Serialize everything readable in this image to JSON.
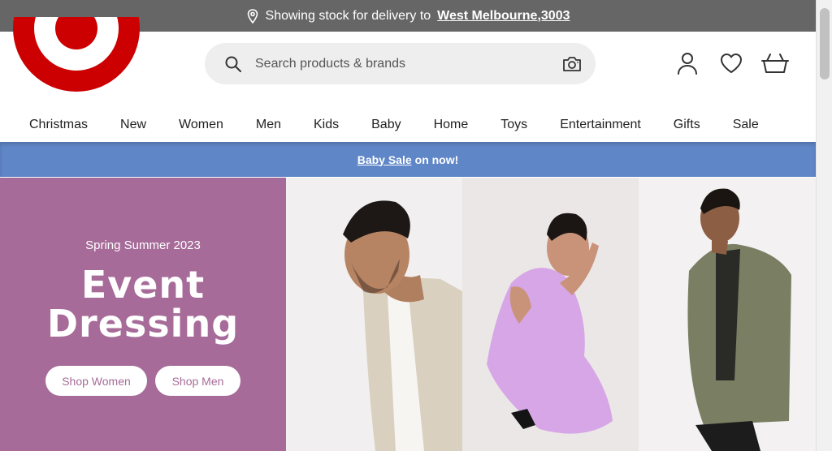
{
  "delivery_bar": {
    "prefix": "Showing stock for delivery to",
    "location": "West Melbourne,3003",
    "pin_icon": "location-pin-icon"
  },
  "header": {
    "logo_icon": "target-bullseye-logo",
    "search": {
      "placeholder": "Search products & brands",
      "icon": "search-icon",
      "camera_icon": "camera-icon"
    },
    "icons": [
      "account-icon",
      "wishlist-heart-icon",
      "cart-basket-icon"
    ]
  },
  "nav": {
    "items": [
      {
        "label": "Christmas"
      },
      {
        "label": "New"
      },
      {
        "label": "Women"
      },
      {
        "label": "Men"
      },
      {
        "label": "Kids"
      },
      {
        "label": "Baby"
      },
      {
        "label": "Home"
      },
      {
        "label": "Toys"
      },
      {
        "label": "Entertainment"
      },
      {
        "label": "Gifts"
      },
      {
        "label": "Sale"
      }
    ]
  },
  "promo": {
    "link_text": "Baby Sale",
    "suffix": "on now!",
    "bg_color": "#5f86c7"
  },
  "hero": {
    "kicker": "Spring Summer 2023",
    "headline_line1": "Event",
    "headline_line2": "Dressing",
    "buttons": {
      "women": "Shop Women",
      "men": "Shop Men"
    },
    "panel_color": "#a66b98"
  },
  "colors": {
    "brand_red": "#cc0000",
    "delivery_bar_bg": "#666666"
  }
}
